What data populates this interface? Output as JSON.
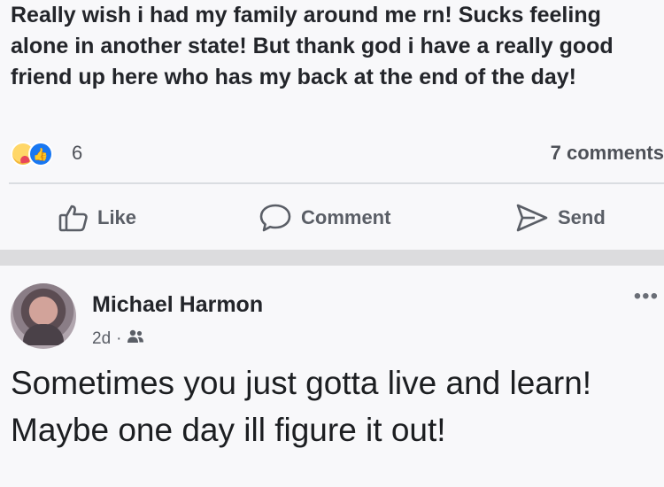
{
  "post1": {
    "text": "Really wish i had my family around me rn! Sucks feeling alone in another state! But thank god i have a really good friend up here who has my back at the end of the day!",
    "reaction_count": "6",
    "comments_label": "7 comments",
    "reaction_icons": [
      "care-reaction-icon",
      "like-reaction-icon"
    ],
    "actions": {
      "like": "Like",
      "comment": "Comment",
      "send": "Send"
    }
  },
  "post2": {
    "author": "Michael Harmon",
    "time": "2d",
    "separator": "·",
    "audience_icon": "friends-icon",
    "more_label": "•••",
    "text": "Sometimes you just gotta live and learn! Maybe one day ill figure it out!"
  },
  "colors": {
    "background": "#f8f8fa",
    "divider": "#dadde1",
    "secondary_text": "#5a5e66",
    "like_blue": "#1877f2"
  }
}
